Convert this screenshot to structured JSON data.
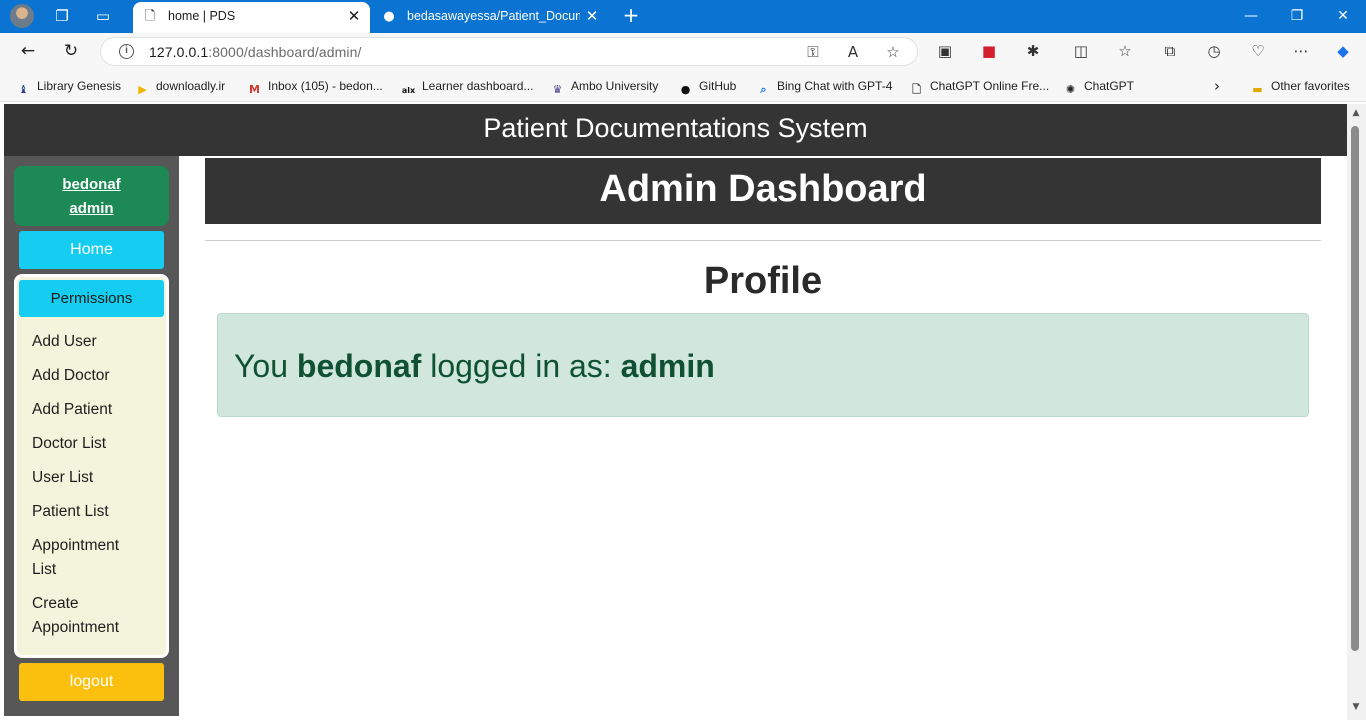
{
  "browser": {
    "active_tab_title": "home | PDS",
    "inactive_tab_title": "bedasawayessa/Patient_Documentations",
    "url_host": "127.0.0.1",
    "url_rest": ":8000/dashboard/admin/",
    "bookmarks": [
      {
        "label": "Library Genesis",
        "icon": "library-genesis-icon"
      },
      {
        "label": "downloadly.ir",
        "icon": "downloadly-icon"
      },
      {
        "label": "Inbox (105) - bedon...",
        "icon": "gmail-icon"
      },
      {
        "label": "Learner dashboard...",
        "icon": "alx-icon"
      },
      {
        "label": "Ambo University",
        "icon": "ambo-university-icon"
      },
      {
        "label": "GitHub",
        "icon": "github-icon"
      },
      {
        "label": "Bing Chat with GPT-4",
        "icon": "search-icon"
      },
      {
        "label": "ChatGPT Online Fre...",
        "icon": "page-icon"
      },
      {
        "label": "ChatGPT",
        "icon": "chatgpt-icon"
      }
    ],
    "other_favorites": "Other favorites"
  },
  "site": {
    "title": "Patient Documentations System"
  },
  "sidebar": {
    "username": "bedonaf",
    "role": "admin",
    "home_label": "Home",
    "permissions_label": "Permissions",
    "items": [
      "Add User",
      "Add Doctor",
      "Add Patient",
      "Doctor List",
      "User List",
      "Patient List",
      "Appointment List",
      "Create Appointment"
    ],
    "logout_label": "logout"
  },
  "main": {
    "dashboard_title": "Admin Dashboard",
    "profile_heading": "Profile",
    "alert": {
      "prefix": "You",
      "username": "bedonaf",
      "middle": "logged in as:",
      "role": "admin"
    }
  },
  "colors": {
    "browser_accent": "#0b73d1",
    "header_bg": "#343434",
    "sidebar_bg": "#575757",
    "user_card": "#1d8a55",
    "info_button": "#14cdf0",
    "logout_button": "#fbc00d",
    "panel_bg": "#f4f3dc",
    "alert_bg": "#d1e7dd",
    "alert_text": "#0f5132"
  }
}
